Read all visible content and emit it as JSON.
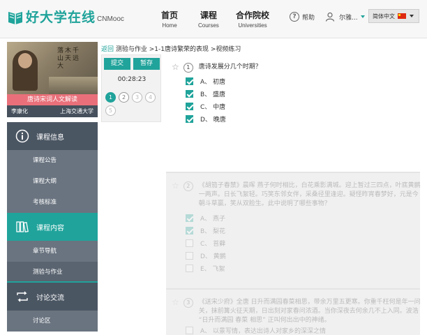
{
  "header": {
    "logo_text": "好大学在线",
    "logo_sub": "CNMooc",
    "nav": [
      {
        "cn": "首页",
        "en": "Home"
      },
      {
        "cn": "课程",
        "en": "Courses"
      },
      {
        "cn": "合作院校",
        "en": "Universities"
      }
    ],
    "help_label": "帮助",
    "user_label": "尔雅...",
    "lang_label": "简体中文"
  },
  "course": {
    "title": "唐诗宋词人文解读",
    "teacher": "李康化",
    "school": "上海交通大学",
    "calligraphy": "落木千山天远大"
  },
  "menu": {
    "info": "课程信息",
    "info_items": [
      "课程公告",
      "课程大纲",
      "考核标准"
    ],
    "content": "课程内容",
    "content_items": [
      "章节导航",
      "测验与作业"
    ],
    "discuss": "讨论交流",
    "discuss_items": [
      "讨论区"
    ]
  },
  "breadcrumb": {
    "back": "返回",
    "path": "测验与作业 >1-1唐诗繁荣的表现 >视频练习"
  },
  "quiz": {
    "submit": "提交",
    "save": "暂存",
    "timer": "00:28:23",
    "numbers": [
      "1",
      "2",
      "3",
      "4",
      "5"
    ]
  },
  "questions": [
    {
      "no": "1",
      "text": "唐诗发展分几个时期？",
      "options": [
        {
          "label": "A、 初唐",
          "checked": true
        },
        {
          "label": "B、 盛唐",
          "checked": true
        },
        {
          "label": "C、 中唐",
          "checked": true
        },
        {
          "label": "D、 晚唐",
          "checked": true
        }
      ]
    },
    {
      "no": "2",
      "text": "《胡笳子春禁》晨晖 燕子何时相比，白花乘影满城。迎上暂过三四点，叶底黄鹂一两声。日长飞絮轻。巧笑东邻女伴，采桑径里逢迎。疑怪昨宵春梦好，元是今朝斗草赢，笑从双脸生。此中说明了哪些事物？",
      "options": [
        {
          "label": "A、 燕子",
          "checked": true
        },
        {
          "label": "B、 梨花",
          "checked": true
        },
        {
          "label": "C、 苔藓",
          "checked": false
        },
        {
          "label": "D、 黄鹂",
          "checked": false
        },
        {
          "label": "E、 飞絮",
          "checked": false
        }
      ]
    },
    {
      "no": "3",
      "text": "《送宋少府》全唐 日升而满园春菜相思，带余万里五更寒。你重千枉何是年一问关，抹前篝火征天期，日出刻对家春问浓酒。当你深夜去何余几不上入同。波浩 “日升而满园 春菜 相思” 正叫何出出中的神绪。",
      "options": [
        {
          "label": "A、 以景写情，表达出诗人对家乡的深深之情",
          "checked": false
        }
      ]
    }
  ]
}
